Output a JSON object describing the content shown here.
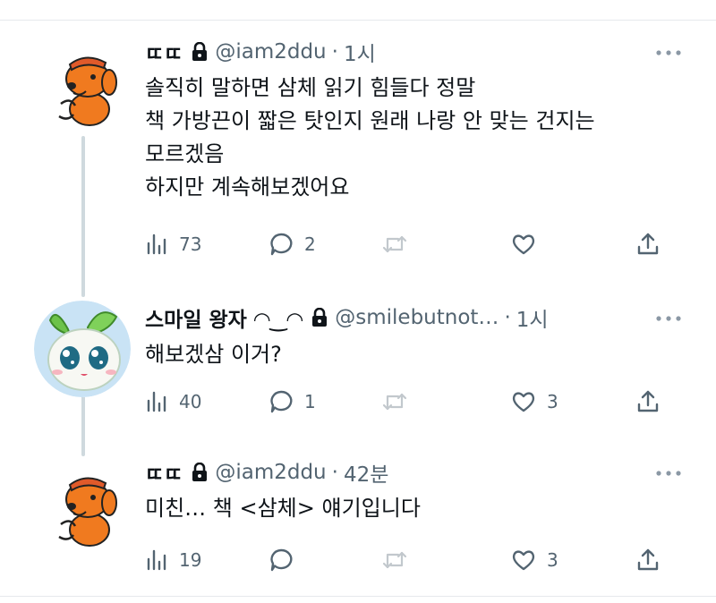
{
  "tweets": [
    {
      "name": "ㄸㄸ",
      "handle": "@iam2ddu",
      "time": "1시",
      "text": "솔직히 말하면 삼체 읽기 힘들다 정말\n책 가방끈이 짧은 탓인지 원래 나랑 안 맞는 건지는\n모르겠음\n하지만 계속해보겠어요",
      "views": "73",
      "replies": "2",
      "retweets": "",
      "likes": ""
    },
    {
      "name": "스마일 왕자 ◠‿◠",
      "handle": "@smilebutnot…",
      "time": "1시",
      "text": "해보겠삼 이거?",
      "views": "40",
      "replies": "1",
      "retweets": "",
      "likes": "3"
    },
    {
      "name": "ㄸㄸ",
      "handle": "@iam2ddu",
      "time": "42분",
      "text": "미친… 책 <삼체> 얘기입니다",
      "views": "19",
      "replies": "",
      "retweets": "",
      "likes": "3"
    }
  ],
  "icons": {
    "lock": "lock-icon",
    "more": "more-dots-icon",
    "views": "views-chart-icon",
    "reply": "reply-bubble-icon",
    "retweet": "retweet-icon",
    "like": "heart-icon",
    "share": "share-icon"
  },
  "colors": {
    "text": "#0f1419",
    "secondary": "#536471",
    "thread_line": "#cfd9de",
    "divider": "#e6e9ec",
    "dog_orange": "#f07a1f"
  }
}
